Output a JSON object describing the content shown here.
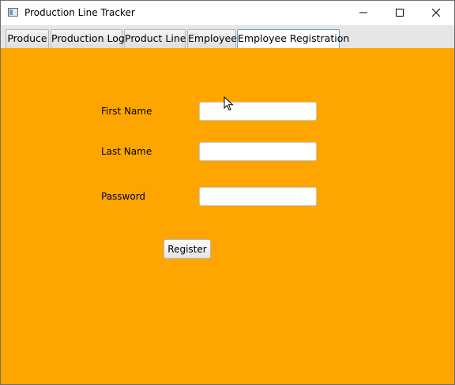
{
  "window": {
    "title": "Production Line Tracker",
    "icon": "app-window-icon",
    "controls": [
      "minimize-icon",
      "maximize-icon",
      "close-icon"
    ]
  },
  "tabs": [
    {
      "label": "Produce",
      "selected": false
    },
    {
      "label": "Production Log",
      "selected": false
    },
    {
      "label": "Product Line",
      "selected": false
    },
    {
      "label": "Employee",
      "selected": false
    },
    {
      "label": "Employee Registration",
      "selected": true
    }
  ],
  "form": {
    "background_color": "#ffa500",
    "first_name_label": "First Name",
    "first_name_value": "",
    "last_name_label": "Last Name",
    "last_name_value": "",
    "password_label": "Password",
    "password_value": "",
    "register_label": "Register"
  },
  "cursor": "mouse-pointer-icon"
}
